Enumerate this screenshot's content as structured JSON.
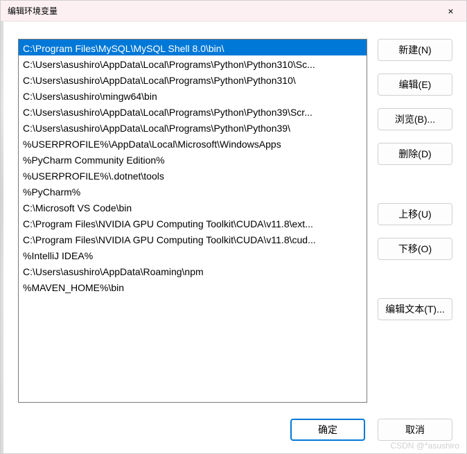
{
  "dialog": {
    "title": "编辑环境变量",
    "close": "×"
  },
  "paths": [
    "C:\\Program Files\\MySQL\\MySQL Shell 8.0\\bin\\",
    "C:\\Users\\asushiro\\AppData\\Local\\Programs\\Python\\Python310\\Sc...",
    "C:\\Users\\asushiro\\AppData\\Local\\Programs\\Python\\Python310\\",
    "C:\\Users\\asushiro\\mingw64\\bin",
    "C:\\Users\\asushiro\\AppData\\Local\\Programs\\Python\\Python39\\Scr...",
    "C:\\Users\\asushiro\\AppData\\Local\\Programs\\Python\\Python39\\",
    "%USERPROFILE%\\AppData\\Local\\Microsoft\\WindowsApps",
    "%PyCharm Community Edition%",
    "%USERPROFILE%\\.dotnet\\tools",
    "%PyCharm%",
    "C:\\Microsoft VS Code\\bin",
    "C:\\Program Files\\NVIDIA GPU Computing Toolkit\\CUDA\\v11.8\\ext...",
    "C:\\Program Files\\NVIDIA GPU Computing Toolkit\\CUDA\\v11.8\\cud...",
    "%IntelliJ IDEA%",
    "C:\\Users\\asushiro\\AppData\\Roaming\\npm",
    "%MAVEN_HOME%\\bin"
  ],
  "buttons": {
    "new": "新建(N)",
    "edit": "编辑(E)",
    "browse": "浏览(B)...",
    "delete": "删除(D)",
    "moveUp": "上移(U)",
    "moveDown": "下移(O)",
    "editText": "编辑文本(T)...",
    "ok": "确定",
    "cancel": "取消"
  },
  "watermark": "CSDN @*asushiro"
}
